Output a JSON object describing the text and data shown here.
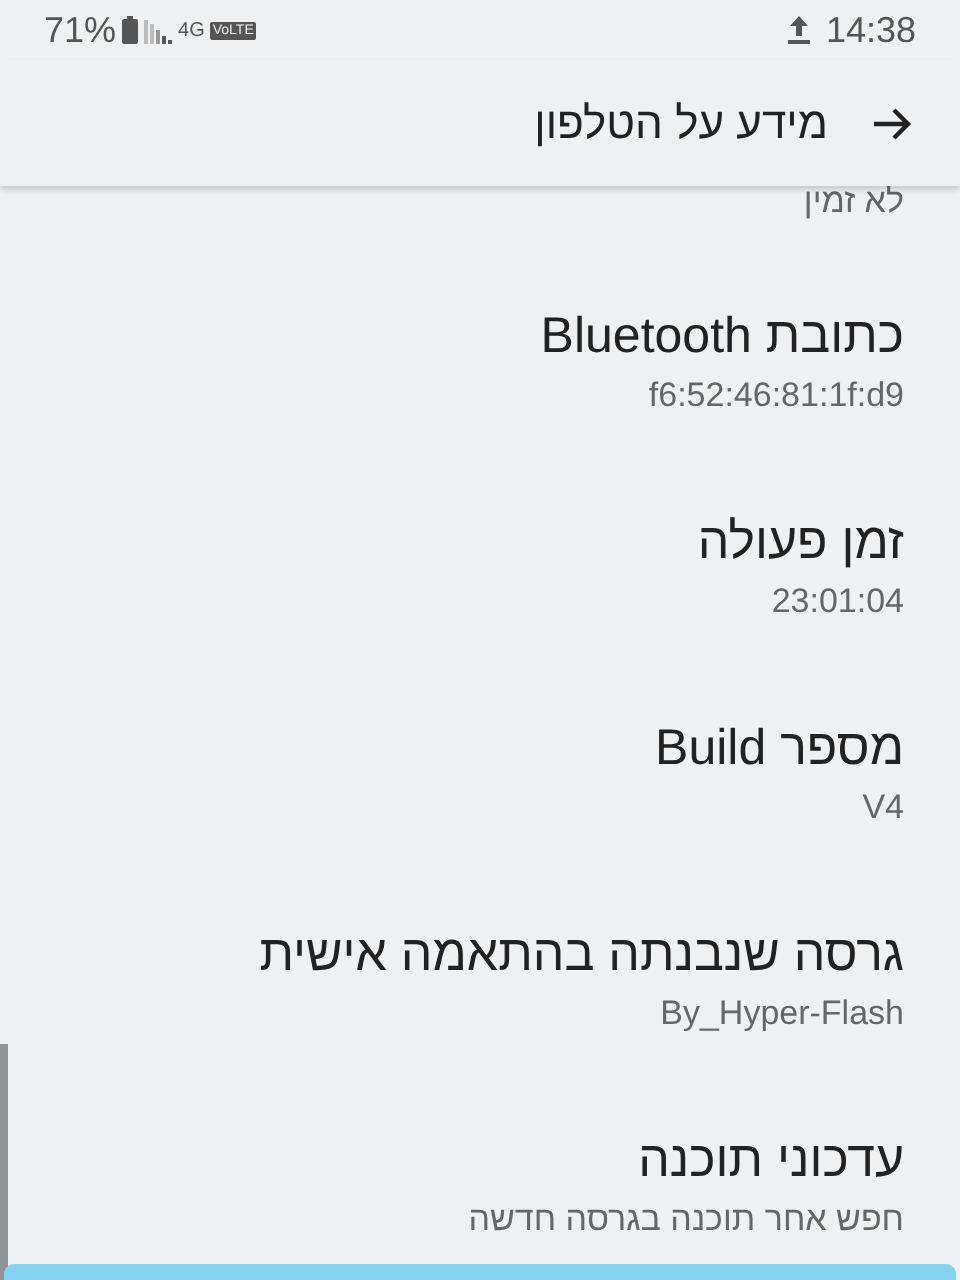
{
  "status_bar": {
    "battery": "71%",
    "network": "4G",
    "volte": "VoLTE",
    "time": "14:38"
  },
  "header": {
    "title": "מידע על הטלפון"
  },
  "partial_item": {
    "subtitle": "לא זמין"
  },
  "items": [
    {
      "title": "כתובת Bluetooth",
      "subtitle": "f6:52:46:81:1f:d9"
    },
    {
      "title": "זמן פעולה",
      "subtitle": "23:01:04"
    },
    {
      "title": "מספר Build",
      "subtitle": "V4"
    },
    {
      "title": "גרסה שנבנתה בהתאמה אישית",
      "subtitle": "By_Hyper-Flash"
    },
    {
      "title": "עדכוני תוכנה",
      "subtitle": "חפש אחר תוכנה בגרסה חדשה"
    }
  ]
}
